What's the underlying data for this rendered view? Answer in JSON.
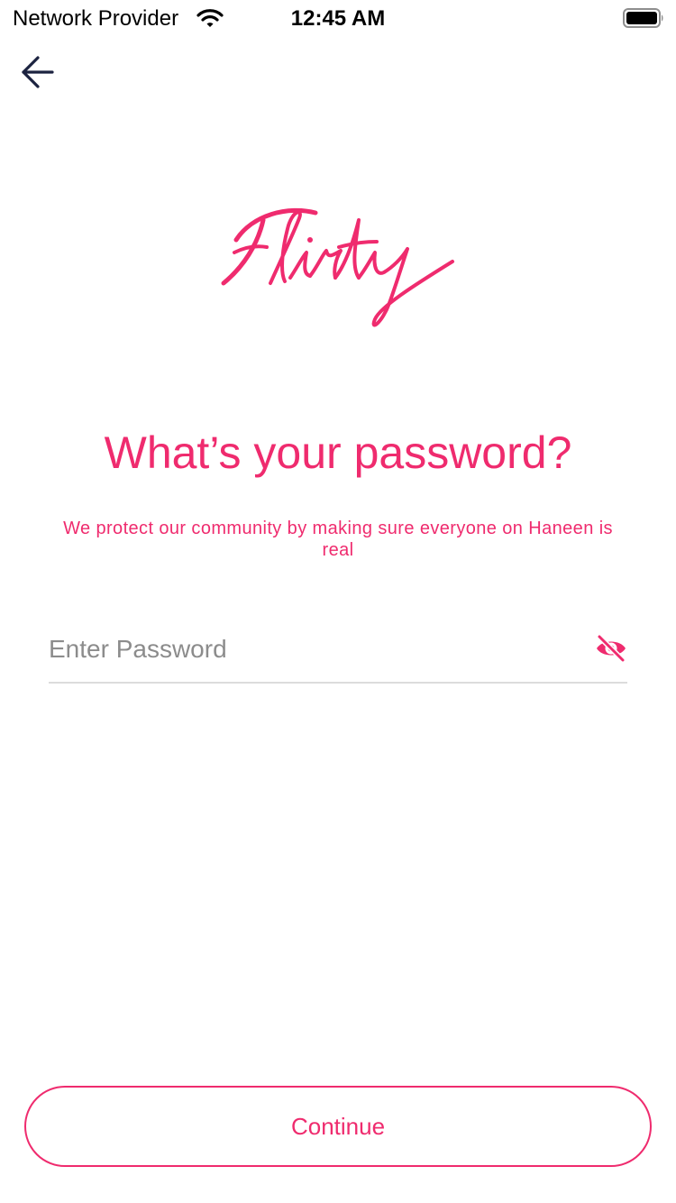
{
  "status_bar": {
    "carrier": "Network Provider",
    "time": "12:45 AM",
    "wifi_icon": "wifi-icon",
    "battery_icon": "battery-icon"
  },
  "nav": {
    "back_icon": "arrow-left-icon"
  },
  "brand": {
    "logo_text": "Flirty",
    "color": "#ef2b6e"
  },
  "screen": {
    "title": "What’s your password?",
    "subtitle": "We protect our community by making sure everyone on Haneen is real"
  },
  "password": {
    "placeholder": "Enter Password",
    "value": "",
    "visibility_icon": "eye-off-icon"
  },
  "actions": {
    "continue_label": "Continue"
  },
  "colors": {
    "accent": "#ef2b6e",
    "divider": "#dcdcdc",
    "placeholder": "#8c8c8c",
    "back_icon": "#1c2340"
  }
}
